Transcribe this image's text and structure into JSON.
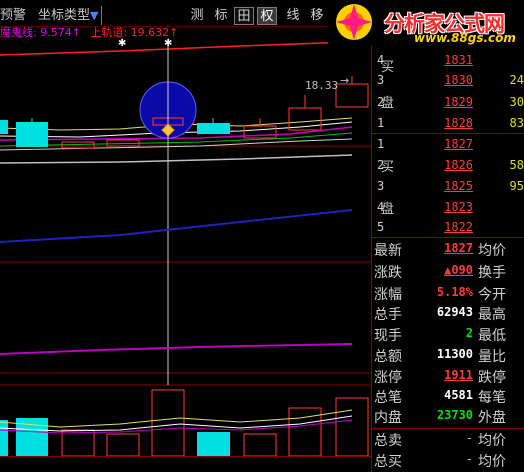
{
  "toolbar": {
    "warning_label": "预警",
    "coord_label": "坐标类型",
    "coord_dropdown": "▼",
    "btn_measure": "测",
    "btn_mark": "标",
    "btn_cross": "田",
    "btn_rights": "权",
    "btn_line": "线",
    "btn_move": "移"
  },
  "indicator_header": {
    "text1": "魔鬼线: 9.574",
    "text1_arrow": "↑",
    "text2": "上轨道: 19.632",
    "text2_arrow": "↑"
  },
  "chart": {
    "price_label": "18.33"
  },
  "logo": {
    "title": "分析家公式网",
    "subtitle": "www.88gs.com"
  },
  "order_book": {
    "sell_label_1": "买",
    "sell_label_2": "盘",
    "buy_label_1": "买",
    "buy_label_2": "盘",
    "asks": [
      {
        "level": "4",
        "price": "1831",
        "volume": ""
      },
      {
        "level": "3",
        "price": "1830",
        "volume": "24"
      },
      {
        "level": "2",
        "price": "1829",
        "volume": "30"
      },
      {
        "level": "1",
        "price": "1828",
        "volume": "83"
      }
    ],
    "bids": [
      {
        "level": "1",
        "price": "1827",
        "volume": ""
      },
      {
        "level": "2",
        "price": "1826",
        "volume": "58"
      },
      {
        "level": "3",
        "price": "1825",
        "volume": "95"
      },
      {
        "level": "4",
        "price": "1823",
        "volume": ""
      },
      {
        "level": "5",
        "price": "1822",
        "volume": ""
      }
    ]
  },
  "quote": {
    "rows": [
      {
        "label": "最新",
        "value": "1827",
        "value_color": "red",
        "underline": true,
        "label2": "均价"
      },
      {
        "label": "涨跌",
        "value": "▲090",
        "value_color": "red",
        "underline": true,
        "label2": "换手"
      },
      {
        "label": "涨幅",
        "value": "5.18%",
        "value_color": "red",
        "underline": false,
        "label2": "今开"
      },
      {
        "label": "总手",
        "value": "62943",
        "value_color": "white",
        "underline": false,
        "label2": "最高"
      },
      {
        "label": "现手",
        "value": "2",
        "value_color": "green",
        "underline": false,
        "label2": "最低"
      },
      {
        "label": "总额",
        "value": "11300",
        "value_color": "white",
        "underline": false,
        "label2": "量比"
      },
      {
        "label": "涨停",
        "value": "1911",
        "value_color": "red",
        "underline": true,
        "label2": "跌停"
      },
      {
        "label": "总笔",
        "value": "4581",
        "value_color": "white",
        "underline": false,
        "label2": "每笔"
      },
      {
        "label": "内盘",
        "value": "23730",
        "value_color": "green",
        "underline": false,
        "label2": "外盘"
      },
      {
        "label": "总卖",
        "value": "-",
        "value_color": "gray",
        "underline": false,
        "label2": "均价"
      },
      {
        "label": "总买",
        "value": "-",
        "value_color": "gray",
        "underline": false,
        "label2": "均价"
      }
    ]
  },
  "colors": {
    "up": "#ff3a3a",
    "down": "#00e0e0",
    "grid": "#8b0000",
    "volume": "#ffff00",
    "ma_blue": "#2020c0",
    "ma_magenta": "#c000c0"
  }
}
